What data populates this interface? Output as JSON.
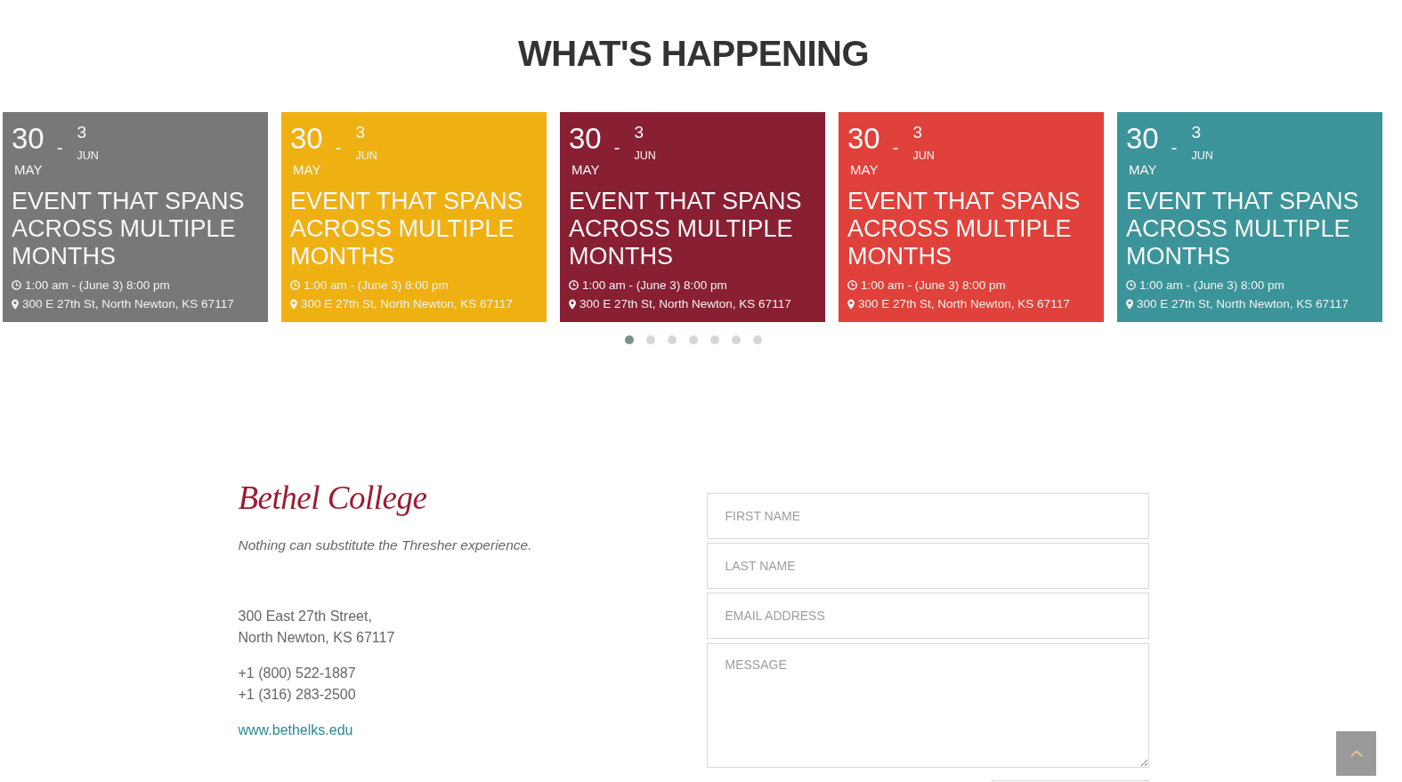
{
  "section": {
    "title": "WHAT'S HAPPENING"
  },
  "events": [
    {
      "start_day": "30",
      "start_month": "MAY",
      "separator": "-",
      "end_day": "3",
      "end_month": "JUN",
      "title": "EVENT THAT SPANS ACROSS MULTIPLE MONTHS",
      "time": "1:00 am - (June 3) 8:00 pm",
      "location": "300 E 27th St, North Newton, KS 67117",
      "color": "#787878"
    },
    {
      "start_day": "30",
      "start_month": "MAY",
      "separator": "-",
      "end_day": "3",
      "end_month": "JUN",
      "title": "EVENT THAT SPANS ACROSS MULTIPLE MONTHS",
      "time": "1:00 am - (June 3) 8:00 pm",
      "location": "300 E 27th St, North Newton, KS 67117",
      "color": "#efb112"
    },
    {
      "start_day": "30",
      "start_month": "MAY",
      "separator": "-",
      "end_day": "3",
      "end_month": "JUN",
      "title": "EVENT THAT SPANS ACROSS MULTIPLE MONTHS",
      "time": "1:00 am - (June 3) 8:00 pm",
      "location": "300 E 27th St, North Newton, KS 67117",
      "color": "#891f32"
    },
    {
      "start_day": "30",
      "start_month": "MAY",
      "separator": "-",
      "end_day": "3",
      "end_month": "JUN",
      "title": "EVENT THAT SPANS ACROSS MULTIPLE MONTHS",
      "time": "1:00 am - (June 3) 8:00 pm",
      "location": "300 E 27th St, North Newton, KS 67117",
      "color": "#e0413a"
    },
    {
      "start_day": "30",
      "start_month": "MAY",
      "separator": "-",
      "end_day": "3",
      "end_month": "JUN",
      "title": "EVENT THAT SPANS ACROSS MULTIPLE MONTHS",
      "time": "1:00 am - (June 3) 8:00 pm",
      "location": "300 E 27th St, North Newton, KS 67117",
      "color": "#3b9499"
    }
  ],
  "carousel": {
    "dots": [
      {
        "selected": true
      },
      {
        "selected": false
      },
      {
        "selected": false
      },
      {
        "selected": false
      },
      {
        "selected": false
      },
      {
        "selected": false
      },
      {
        "selected": false
      }
    ]
  },
  "footer": {
    "logo": "Bethel College",
    "tagline": "Nothing can substitute the Thresher experience.",
    "address_lines": [
      "300 East 27th Street,",
      "North Newton, KS 67117"
    ],
    "phones": [
      "+1 (800) 522-1887",
      "+1 (316) 283-2500"
    ],
    "website": "www.bethelks.edu"
  },
  "contact_form": {
    "fields": [
      {
        "kind": "text",
        "placeholder": "FIRST NAME"
      },
      {
        "kind": "text",
        "placeholder": "LAST NAME"
      },
      {
        "kind": "text",
        "placeholder": "EMAIL ADDRESS"
      },
      {
        "kind": "textarea",
        "placeholder": "MESSAGE"
      }
    ]
  }
}
